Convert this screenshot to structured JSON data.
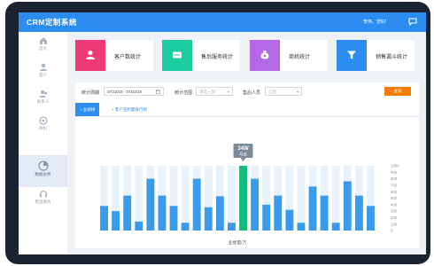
{
  "app": {
    "title": "CRM定制系统",
    "greeting": "李伟，您好!"
  },
  "sidebar": {
    "items": [
      {
        "label": "首页",
        "icon": "home-icon"
      },
      {
        "label": "客户",
        "icon": "user-icon"
      },
      {
        "label": "联系人",
        "icon": "contacts-icon"
      },
      {
        "label": "商机",
        "icon": "target-icon"
      },
      {
        "label": "数据分析",
        "icon": "pie-chart-icon",
        "active": true
      },
      {
        "label": "售后服务",
        "icon": "headset-icon"
      }
    ]
  },
  "cards": [
    {
      "label": "客户数统计",
      "color": "#f03a78",
      "icon": "person-icon"
    },
    {
      "label": "售后服务统计",
      "color": "#1ccc9e",
      "icon": "ticket-icon"
    },
    {
      "label": "商机统计",
      "color": "#b46ae8",
      "icon": "money-bag-icon"
    },
    {
      "label": "销售漏斗统计",
      "color": "#2d8cf0",
      "icon": "funnel-icon"
    }
  ],
  "filters": {
    "period_label": "统计周期",
    "period_value": "07/22/15 - 07/22/15",
    "range_label": "统计范围",
    "range_placeholder": "请选一部",
    "person_label": "售后人员",
    "person_value": "全部",
    "query_label": "查询"
  },
  "tabs": [
    {
      "label": "+ 业绩榜",
      "active": true
    },
    {
      "label": "+ 客户签约量排行榜",
      "active": false
    }
  ],
  "chart_data": {
    "type": "bar",
    "xlabel": "业绩量/万",
    "ylim": [
      0,
      1000
    ],
    "yticks": [
      0,
      100,
      200,
      300,
      400,
      500,
      600,
      700,
      800,
      900,
      1000
    ],
    "tooltip": {
      "value": "34W",
      "name": "马云"
    },
    "highlight_index": 12,
    "values": [
      380,
      300,
      540,
      140,
      800,
      540,
      380,
      120,
      800,
      360,
      530,
      120,
      1000,
      800,
      400,
      540,
      320,
      120,
      680,
      540,
      120,
      760,
      540,
      380
    ],
    "colors": {
      "bar": "#3a9bea",
      "highlight": "#15b87f",
      "track": "#e9f2fb"
    }
  }
}
